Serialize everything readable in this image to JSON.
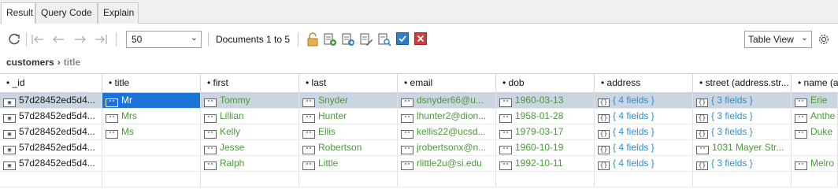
{
  "tabs": [
    "Result",
    "Query Code",
    "Explain"
  ],
  "toolbar": {
    "page_size": "50",
    "documents_label": "Documents 1 to 5",
    "view_mode": "Table View"
  },
  "breadcrumb": {
    "collection": "customers",
    "field": "title"
  },
  "columns": [
    "_id",
    "title",
    "first",
    "last",
    "email",
    "dob",
    "address",
    "street (address.str...",
    "name (a"
  ],
  "rows": [
    [
      "57d28452ed5d4...",
      "Mr",
      "Tommy",
      "Snyder",
      "dsnyder66@u...",
      "1960-03-13",
      "{ 4 fields }",
      "{ 3 fields }",
      "Erie"
    ],
    [
      "57d28452ed5d4...",
      "Mrs",
      "Lillian",
      "Hunter",
      "lhunter2@dion...",
      "1958-01-28",
      "{ 4 fields }",
      "{ 3 fields }",
      "Anthe"
    ],
    [
      "57d28452ed5d4...",
      "Ms",
      "Kelly",
      "Ellis",
      "kellis22@ucsd...",
      "1979-03-17",
      "{ 4 fields }",
      "{ 3 fields }",
      "Duke"
    ],
    [
      "57d28452ed5d4...",
      "",
      "Jesse",
      "Robertson",
      "jrobertsonx@n...",
      "1960-10-19",
      "{ 4 fields }",
      "1031 Mayer Str...",
      ""
    ],
    [
      "57d28452ed5d4...",
      "",
      "Ralph",
      "Little",
      "rlittle2u@si.edu",
      "1992-10-11",
      "{ 4 fields }",
      "{ 3 fields }",
      "Melro"
    ]
  ],
  "colors": {
    "selected_row": "#cbd5e1",
    "active_cell": "#1e73d6",
    "string_value": "#4a9a3a",
    "object_value": "#2e8fd0"
  }
}
